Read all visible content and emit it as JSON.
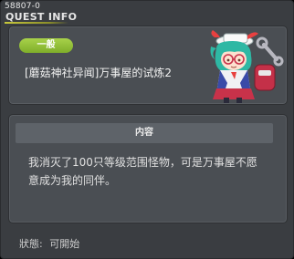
{
  "window": {
    "id": "58807-0",
    "title": "QUEST INFO"
  },
  "quest": {
    "category": "一般",
    "name": "[蘑菇神社异闻]万事屋的试炼2"
  },
  "content": {
    "header": "内容",
    "text": "我消灭了100只等级范围怪物，可是万事屋不愿意成为我的同伴。"
  },
  "status": {
    "label": "狀態:",
    "value": "可開始"
  },
  "colors": {
    "badge": "#8fbf35",
    "panel": "#4a4e53",
    "window": "#3a3d41"
  }
}
